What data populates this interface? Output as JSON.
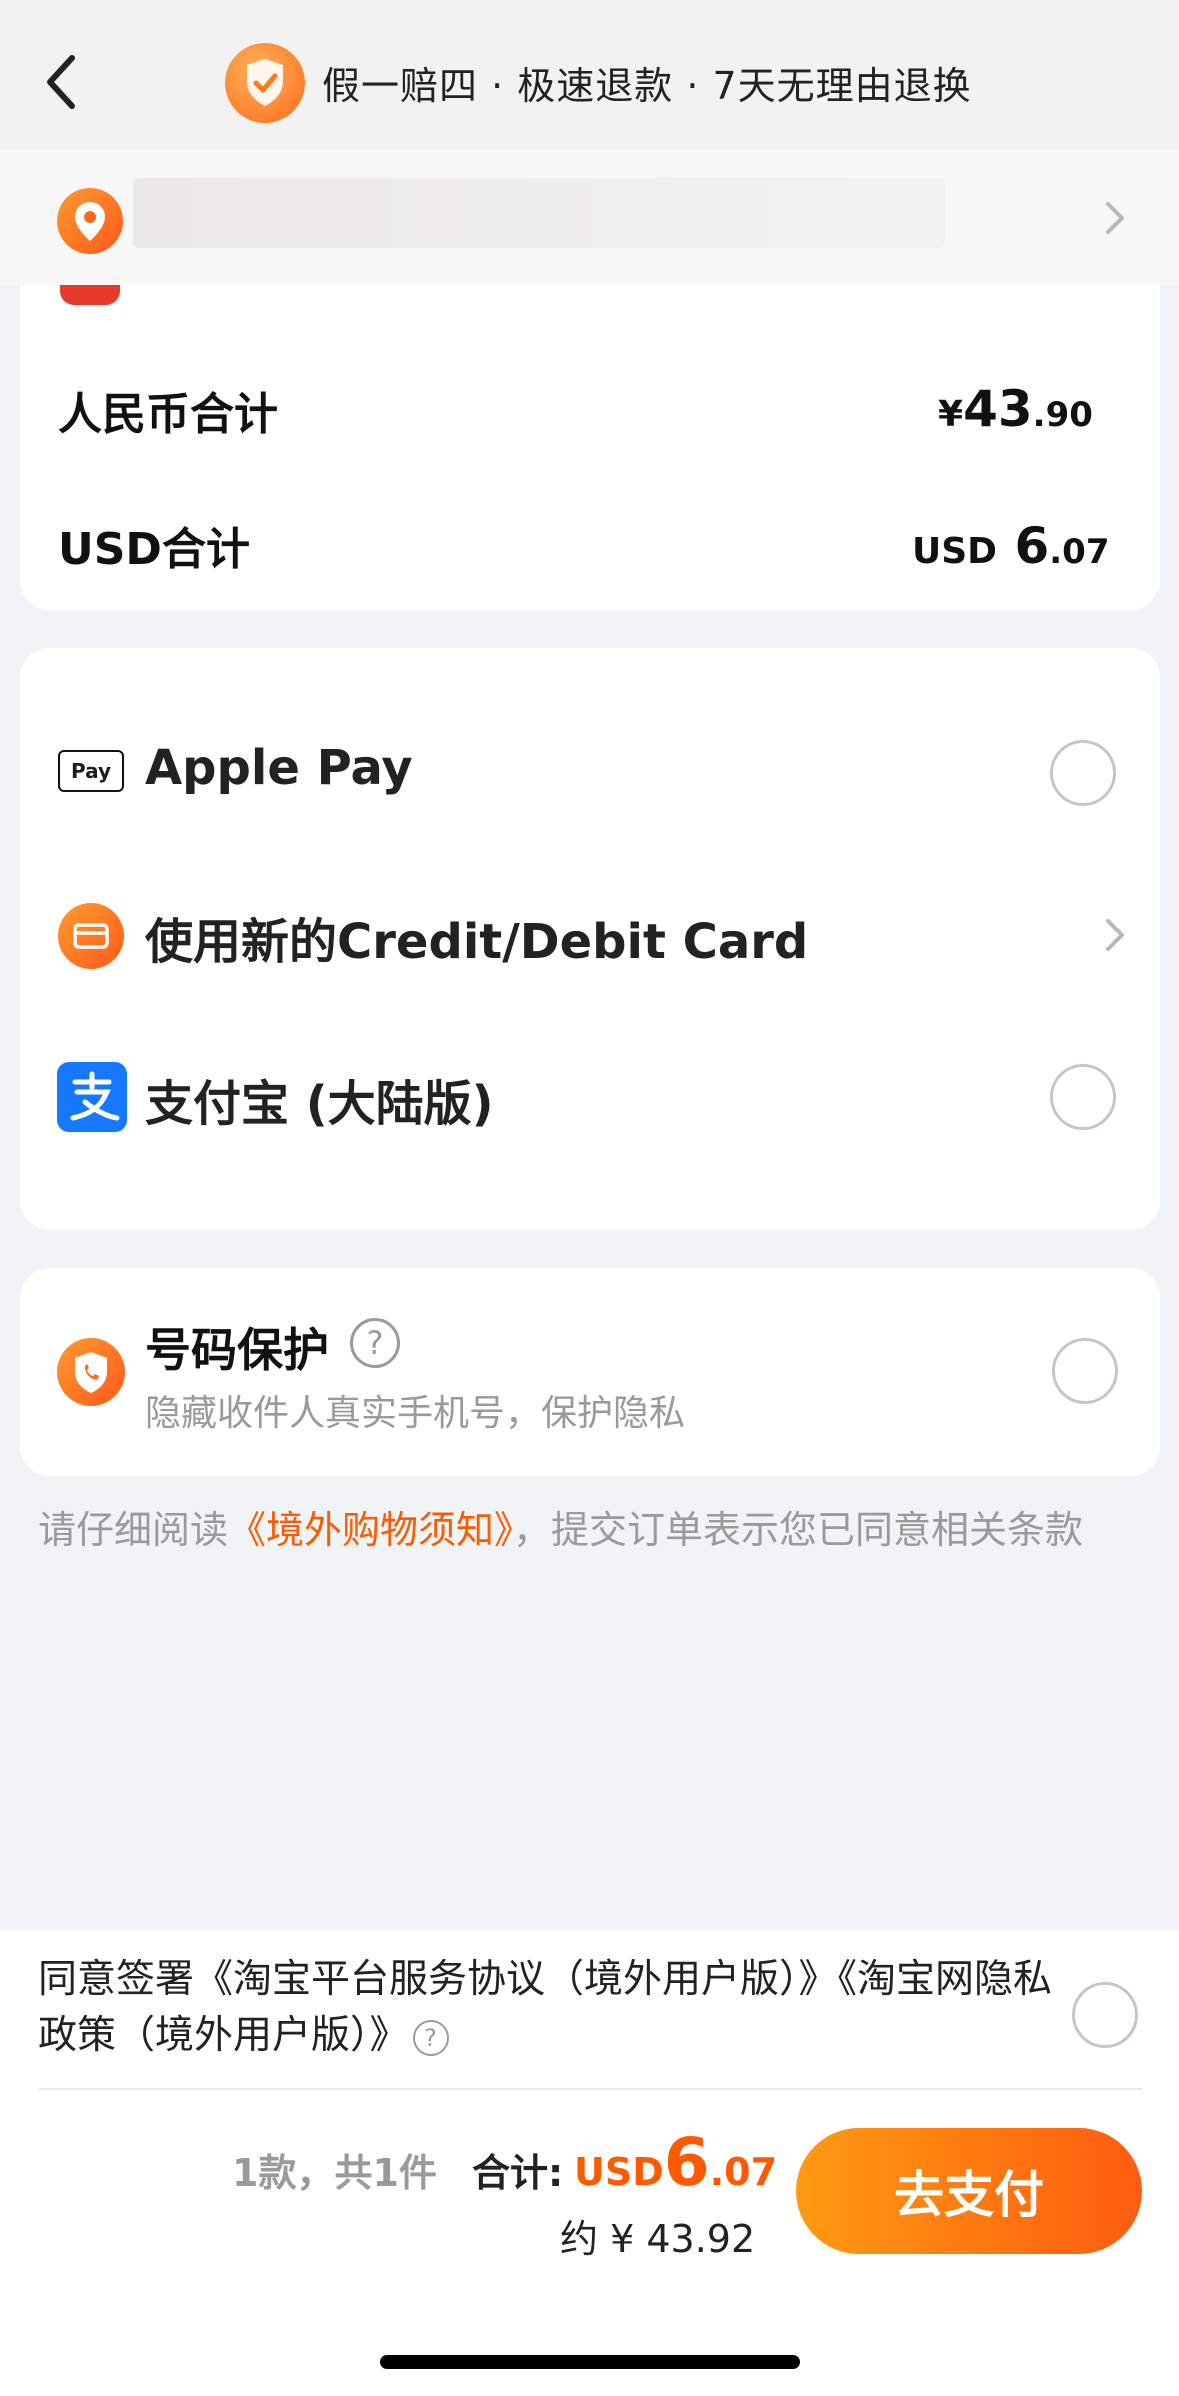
{
  "header": {
    "title": "假一赔四 · 极速退款 · 7天无理由退换"
  },
  "summary": {
    "cny_label": "人民币合计",
    "cny_symbol": "¥",
    "cny_integer": "43",
    "cny_decimal": ".90",
    "usd_label": "USD合计",
    "usd_prefix": "USD",
    "usd_integer": "6",
    "usd_decimal": ".07"
  },
  "payment": {
    "apple_pay_badge": "Pay",
    "apple_pay": "Apple Pay",
    "card": "使用新的Credit/Debit Card",
    "alipay": "支付宝 (大陆版)"
  },
  "privacy": {
    "title": "号码保护",
    "subtitle": "隐藏收件人真实手机号，保护隐私"
  },
  "notice": {
    "before": "请仔细阅读",
    "link": "《境外购物须知》",
    "after": "，提交订单表示您已同意相关条款"
  },
  "agreement": {
    "text": "同意签署《淘宝平台服务协议（境外用户版）》《淘宝网隐私政策（境外用户版）》"
  },
  "footer": {
    "count": "1款，共1件",
    "total_label": "合计:",
    "total_prefix": "USD",
    "total_integer": "6",
    "total_decimal": ".07",
    "approx": "约 ¥ 43.92",
    "pay_button": "去支付"
  },
  "colors": {
    "accent": "#ff5a00",
    "button_start": "#ff9a12",
    "button_end": "#ff5c10",
    "alipay_blue": "#1677ff"
  }
}
